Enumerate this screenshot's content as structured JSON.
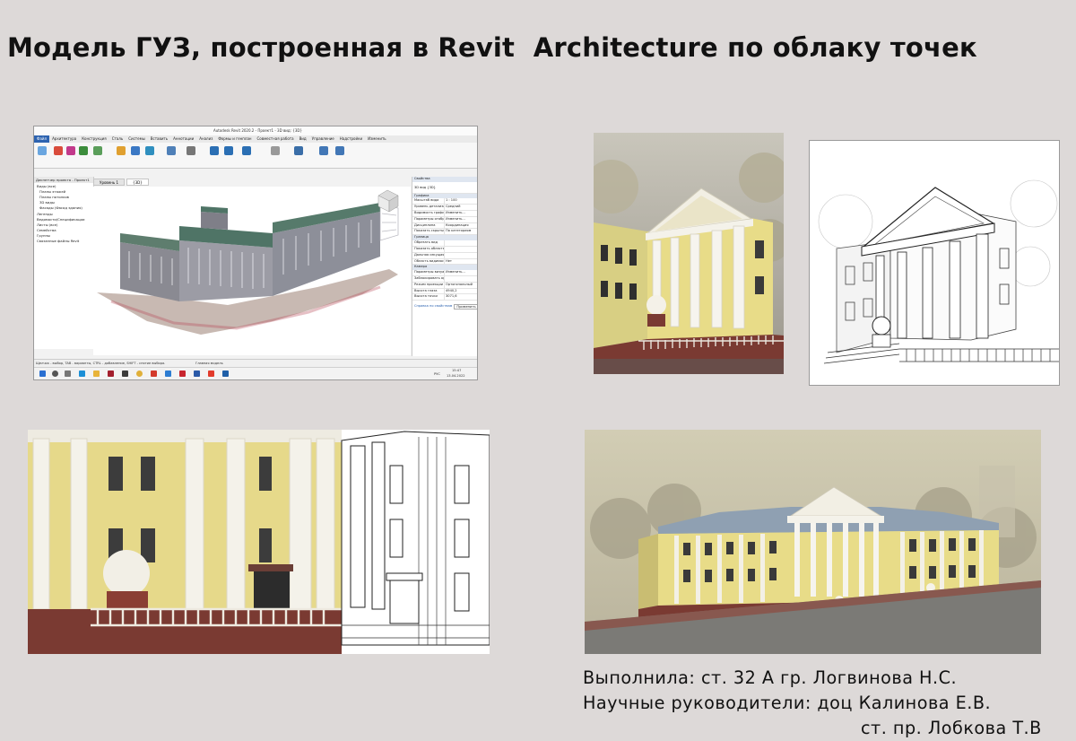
{
  "title": "Модель ГУЗ, построенная в Revit  Architecture по облаку точек",
  "revit": {
    "window_title": "Autodesk Revit 2020.2 - Проект1 - 3D вид: {3D}",
    "ribbon_tabs": [
      "Файл",
      "Архитектура",
      "Конструкция",
      "Сталь",
      "Системы",
      "Вставить",
      "Аннотации",
      "Анализ",
      "Формы и генплан",
      "Совместная работа",
      "Вид",
      "Управление",
      "Надстройки",
      "Изменить"
    ],
    "view_tabs": [
      "Уровень 1",
      "{3D}"
    ],
    "browser": {
      "header": "Диспетчер проекта - Проект1",
      "items": [
        "Виды (все)",
        "Планы этажей",
        "Планы потолков",
        "3D виды",
        "Фасады (Фасад здания)",
        "Легенды",
        "Ведомости/Спецификации",
        "Листы (все)",
        "Семейства",
        "Группы",
        "Связанные файлы Revit"
      ]
    },
    "props": {
      "header": "Свойства",
      "type_name": "3D вид {3D}",
      "section_graphics": "Графика",
      "scale_label": "Масштаб вида",
      "scale_value": "1 : 100",
      "detail_label": "Уровень детализации",
      "detail_value": "Средний",
      "vg_label": "Видимость графики",
      "vg_value": "Изменить...",
      "display_label": "Параметры отображения",
      "display_value": "Изменить...",
      "discipline_label": "Дисциплина",
      "discipline_value": "Координация",
      "hidden_label": "Показать скрытые линии",
      "hidden_value": "По категориям",
      "section_extents": "Граница",
      "crop_label": "Обрезать вид",
      "crop_region_label": "Показать область обрезки",
      "far_clip_label": "Дальняя секущая плоскость",
      "section_box_label": "Область видимости",
      "section_box_value": "Нет",
      "section_camera": "Камера",
      "render_label": "Параметры визуализации",
      "render_value": "Изменить...",
      "lock_label": "Заблокировать ориентацию",
      "projection_label": "Режим проекции",
      "projection_value": "Ортогональный",
      "eye_label": "Высота глаза",
      "eye_value": "4940,2",
      "target_label": "Высота точки",
      "target_value": "3071,6",
      "help_link": "Справка по свойствам",
      "apply_button": "Применить"
    },
    "status_text": "Щелчок - выбор, TAB - варианты, CTRL - добавление, SHIFT - снятие выбора.",
    "status_model": "Главная модель",
    "taskbar_lang": "РУС",
    "taskbar_time": "15:47",
    "taskbar_date": "13.04.2022"
  },
  "credits": {
    "line1": "Выполнила: ст. 32 А гр. Логвинова Н.С.",
    "line2": "Научные руководители: доц Калинова Е.В.",
    "line3": "ст. пр. Лобкова Т.В"
  },
  "colors": {
    "background": "#ddd9d8",
    "facade_yellow": "#e8dc88",
    "column_white": "#f4f2ea",
    "brick_base": "#7a3a32",
    "revit_accent": "#2d63b0"
  }
}
